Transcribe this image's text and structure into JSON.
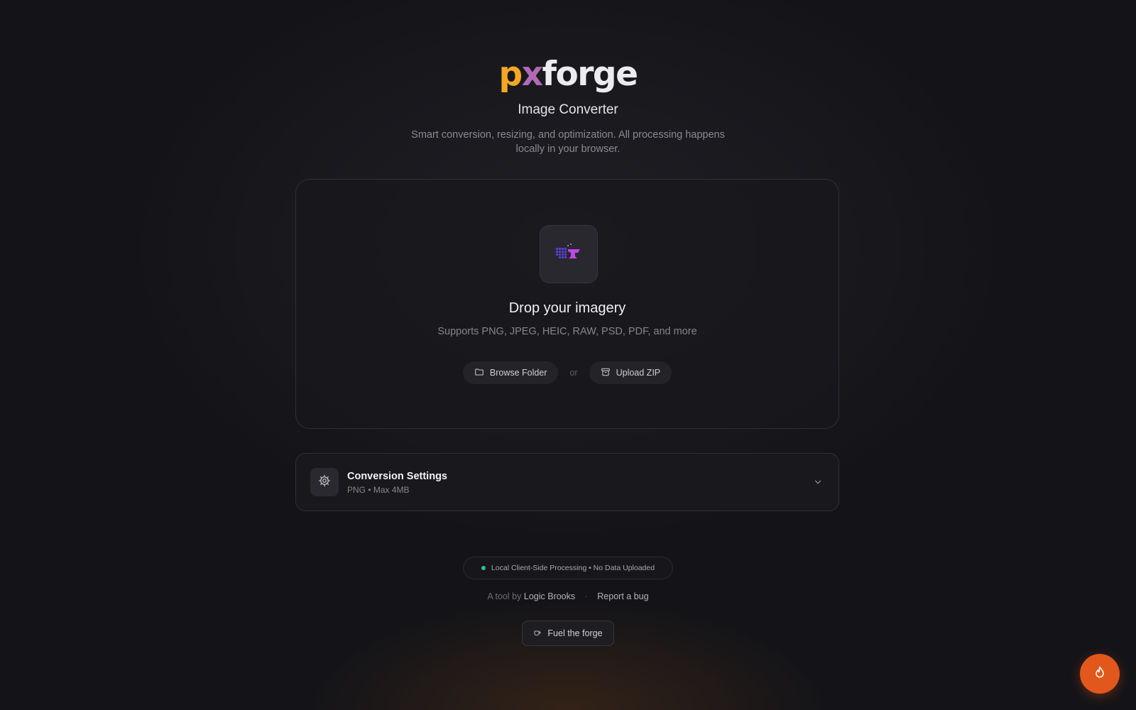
{
  "brand": {
    "prefix_p": "p",
    "prefix_x": "x",
    "suffix": "forge"
  },
  "header": {
    "subtitle": "Image Converter",
    "description": "Smart conversion, resizing, and optimization. All processing happens locally in your browser."
  },
  "dropzone": {
    "icon": "pixel-anvil-icon",
    "title": "Drop your imagery",
    "supported": "Supports PNG, JPEG, HEIC, RAW, PSD, PDF, and more",
    "browse_label": "Browse Folder",
    "or_label": "or",
    "zip_label": "Upload ZIP"
  },
  "settings": {
    "icon": "gear-icon",
    "title": "Conversion Settings",
    "summary": "PNG • Max 4MB"
  },
  "footer": {
    "privacy": "Local Client-Side Processing • No Data Uploaded",
    "tool_by": "A tool by",
    "author": "Logic Brooks",
    "separator": "·",
    "report": "Report a bug",
    "fuel_label": "Fuel the forge"
  },
  "colors": {
    "background": "#141418",
    "logo_p": "#f5a623",
    "logo_x": "#b06ab3",
    "status_dot": "#2fbf8f",
    "fab": "#e2571b"
  }
}
